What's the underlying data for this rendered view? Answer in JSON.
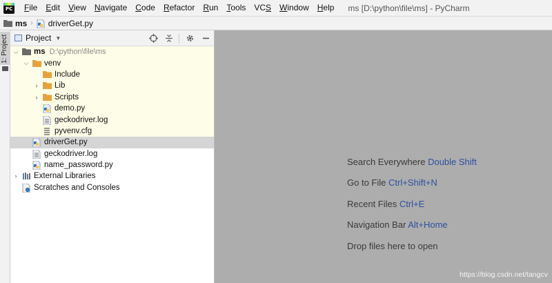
{
  "menubar": {
    "app_icon_text": "PC",
    "items": [
      {
        "u": "F",
        "rest": "ile"
      },
      {
        "u": "E",
        "rest": "dit"
      },
      {
        "u": "V",
        "rest": "iew"
      },
      {
        "u": "N",
        "rest": "avigate"
      },
      {
        "u": "C",
        "rest": "ode"
      },
      {
        "u": "R",
        "rest": "efactor"
      },
      {
        "u": "R",
        "rest": "un"
      },
      {
        "u": "T",
        "rest": "ools"
      },
      {
        "pre": "VC",
        "u": "S",
        "rest": ""
      },
      {
        "u": "W",
        "rest": "indow"
      },
      {
        "u": "H",
        "rest": "elp"
      }
    ],
    "window_title": "ms [D:\\python\\file\\ms] - PyCharm"
  },
  "breadcrumb": {
    "root": "ms",
    "file": "driverGet.py"
  },
  "stripe": {
    "tab_label": "1: Project"
  },
  "project_panel": {
    "title": "Project",
    "icons": [
      "crosshair-icon",
      "collapse-icon",
      "gear-icon",
      "minimize-icon"
    ],
    "tree": {
      "root_label": "ms",
      "root_path": "D:\\python\\file\\ms",
      "venv": "venv",
      "include": "Include",
      "lib": "Lib",
      "scripts": "Scripts",
      "demo": "demo.py",
      "gecko_venv": "geckodriver.log",
      "pyvenv": "pyvenv.cfg",
      "driverget": "driverGet.py",
      "gecko_root": "geckodriver.log",
      "name_password": "name_password.py",
      "external_libraries": "External Libraries",
      "scratches": "Scratches and Consoles"
    }
  },
  "editor": {
    "hints": [
      {
        "text": "Search Everywhere",
        "key": "Double Shift"
      },
      {
        "text": "Go to File",
        "key": "Ctrl+Shift+N"
      },
      {
        "text": "Recent Files",
        "key": "Ctrl+E"
      },
      {
        "text": "Navigation Bar",
        "key": "Alt+Home"
      },
      {
        "text": "Drop files here to open",
        "key": ""
      }
    ],
    "watermark": "https://blog.csdn.net/tangcv"
  },
  "colors": {
    "accent_key": "#2d50a0",
    "folder": "#e8a23d",
    "venv_bg": "#fefde7",
    "selection": "#d5d5d5",
    "editor_bg": "#adadad"
  }
}
